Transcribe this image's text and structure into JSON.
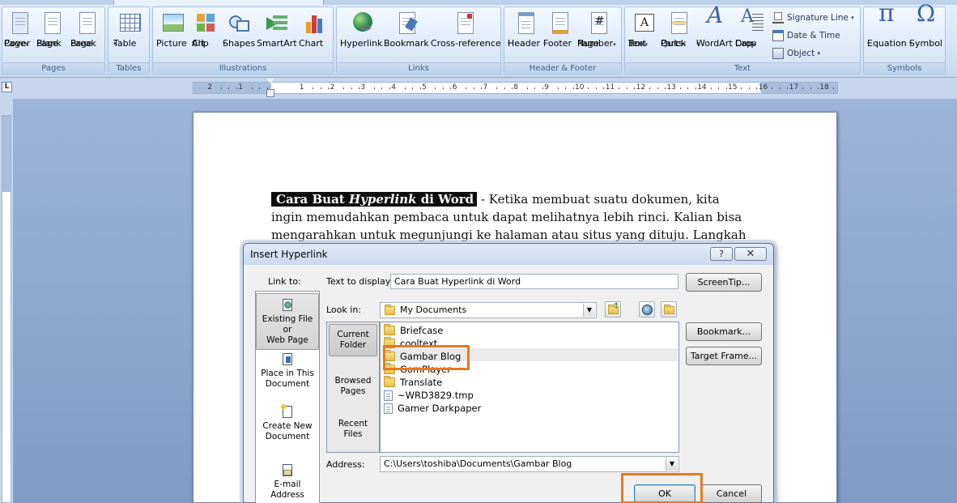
{
  "ribbon": {
    "groups": {
      "pages": "Pages",
      "tables": "Tables",
      "illustrations": "Illustrations",
      "links": "Links",
      "header_footer": "Header & Footer",
      "text": "Text",
      "symbols": "Symbols"
    },
    "buttons": {
      "cover_page": [
        "Cover",
        "Page"
      ],
      "blank_page": [
        "Blank",
        "Page"
      ],
      "page_break": [
        "Page",
        "Break"
      ],
      "table": "Table",
      "picture": "Picture",
      "clip_art": [
        "Clip",
        "Art"
      ],
      "shapes": "Shapes",
      "smartart": "SmartArt",
      "chart": "Chart",
      "hyperlink": "Hyperlink",
      "bookmark": "Bookmark",
      "cross_reference": "Cross-reference",
      "header": "Header",
      "footer": "Footer",
      "page_number": [
        "Page",
        "Number"
      ],
      "text_box": [
        "Text",
        "Box"
      ],
      "quick_parts": [
        "Quick",
        "Parts"
      ],
      "wordart": "WordArt",
      "drop_cap": [
        "Drop",
        "Cap"
      ],
      "signature_line": "Signature Line",
      "date_time": "Date & Time",
      "object": "Object",
      "equation": "Equation",
      "symbol": "Symbol"
    }
  },
  "ruler": {
    "numbers": [
      "2",
      "1",
      "1",
      "2",
      "3",
      "4",
      "5",
      "6",
      "7",
      "8",
      "9",
      "10",
      "11",
      "12",
      "13",
      "14",
      "15",
      "16",
      "17",
      "18"
    ],
    "corner": "L"
  },
  "document": {
    "title_part1": "Cara Buat ",
    "title_italic": "Hyperlink",
    "title_part2": " di Word",
    "body": " - Ketika membuat suatu dokumen, kita ingin memudahkan pembaca untuk dapat melihatnya lebih rinci. Kalian bisa mengarahkan untuk megunjungi ke halaman atau situs yang dituju. Langkah ini"
  },
  "dialog": {
    "title": "Insert Hyperlink",
    "help": "?",
    "close": "✕",
    "link_to_label": "Link to:",
    "text_to_display_label": "Text to display:",
    "text_to_display_value": "Cara Buat Hyperlink di Word",
    "screentip_button": "ScreenTip...",
    "look_in_label": "Look in:",
    "look_in_value": "My Documents",
    "bookmark_button": "Bookmark...",
    "target_frame_button": "Target Frame...",
    "address_label": "Address:",
    "address_value": "C:\\Users\\toshiba\\Documents\\Gambar Blog",
    "ok_button": "OK",
    "cancel_button": "Cancel",
    "link_to_items": [
      {
        "label": [
          "Existing File or",
          "Web Page"
        ],
        "icon": "globe-doc-icon"
      },
      {
        "label": [
          "Place in This",
          "Document"
        ],
        "icon": "doc-anchor-icon"
      },
      {
        "label": [
          "Create New",
          "Document"
        ],
        "icon": "new-doc-icon"
      },
      {
        "label": [
          "E-mail Address"
        ],
        "icon": "mail-doc-icon"
      }
    ],
    "side_nav": [
      {
        "label": [
          "Current",
          "Folder"
        ]
      },
      {
        "label": [
          "Browsed",
          "Pages"
        ]
      },
      {
        "label": [
          "Recent",
          "Files"
        ]
      }
    ],
    "files": [
      {
        "name": "Briefcase",
        "type": "folder"
      },
      {
        "name": "cooltext",
        "type": "folder"
      },
      {
        "name": "Gambar Blog",
        "type": "folder"
      },
      {
        "name": "GomPlayer",
        "type": "folder"
      },
      {
        "name": "Translate",
        "type": "folder"
      },
      {
        "name": "~WRD3829.tmp",
        "type": "file"
      },
      {
        "name": "Gamer Darkpaper",
        "type": "file"
      }
    ],
    "highlight_color": "#e8791f"
  }
}
